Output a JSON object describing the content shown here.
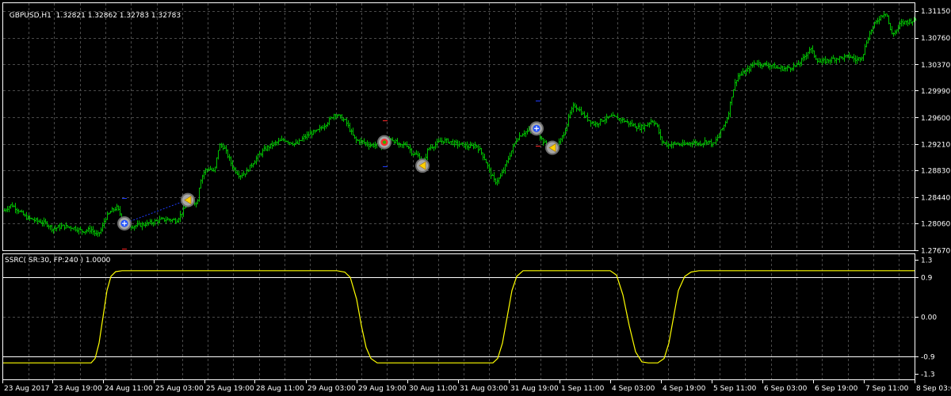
{
  "header": {
    "symbol_tf": "GBPUSD,H1",
    "ohlc": "1.32821 1.32862 1.32783 1.32783"
  },
  "indicator": {
    "label": "SSRC( SR:30, FP:240 ) 1.0000",
    "levels": {
      "upper": 0.9,
      "lower": -0.9
    }
  },
  "colors": {
    "background": "#000000",
    "grid": "#4a4a4a",
    "border": "#ffffff",
    "candles": "#00c000",
    "indicator_line": "#ffff00",
    "level_lines": "#ffffff",
    "signal_up": "#1e3cff",
    "signal_down": "#ff2a2a",
    "marker_ring": "#9a9a9a"
  },
  "chart_data": [
    {
      "type": "line",
      "title": "GBPUSD,H1",
      "y_axis_ticks": [
        "1.31150",
        "1.30760",
        "1.30370",
        "1.29990",
        "1.29600",
        "1.29210",
        "1.28830",
        "1.28440",
        "1.28060",
        "1.27670"
      ],
      "ylim": [
        1.2767,
        1.3125
      ],
      "x_axis_ticks": [
        "23 Aug 2017",
        "23 Aug 19:00",
        "24 Aug 11:00",
        "25 Aug 03:00",
        "25 Aug 19:00",
        "28 Aug 11:00",
        "29 Aug 03:00",
        "29 Aug 19:00",
        "30 Aug 11:00",
        "31 Aug 03:00",
        "31 Aug 19:00",
        "1 Sep 11:00",
        "4 Sep 03:00",
        "4 Sep 19:00",
        "5 Sep 11:00",
        "6 Sep 03:00",
        "6 Sep 19:00",
        "7 Sep 11:00",
        "8 Sep 03:00"
      ],
      "price_path": [
        [
          0,
          1.282
        ],
        [
          8,
          1.2828
        ],
        [
          14,
          1.2833
        ],
        [
          22,
          1.2826
        ],
        [
          32,
          1.2815
        ],
        [
          45,
          1.281
        ],
        [
          58,
          1.2806
        ],
        [
          66,
          1.2798
        ],
        [
          78,
          1.2802
        ],
        [
          92,
          1.28
        ],
        [
          103,
          1.2795
        ],
        [
          115,
          1.2797
        ],
        [
          122,
          1.2788
        ],
        [
          128,
          1.2798
        ],
        [
          132,
          1.2813
        ],
        [
          140,
          1.2824
        ],
        [
          147,
          1.2829
        ],
        [
          152,
          1.2818
        ],
        [
          158,
          1.2805
        ],
        [
          166,
          1.2802
        ],
        [
          178,
          1.2804
        ],
        [
          190,
          1.2807
        ],
        [
          202,
          1.2811
        ],
        [
          212,
          1.2812
        ],
        [
          222,
          1.281
        ],
        [
          230,
          1.2823
        ],
        [
          236,
          1.2835
        ],
        [
          242,
          1.284
        ],
        [
          246,
          1.2836
        ],
        [
          248,
          1.2833
        ],
        [
          252,
          1.2868
        ],
        [
          258,
          1.2883
        ],
        [
          264,
          1.2886
        ],
        [
          270,
          1.288
        ],
        [
          276,
          1.292
        ],
        [
          282,
          1.2917
        ],
        [
          288,
          1.2902
        ],
        [
          294,
          1.2886
        ],
        [
          302,
          1.2876
        ],
        [
          310,
          1.288
        ],
        [
          318,
          1.2893
        ],
        [
          326,
          1.2905
        ],
        [
          334,
          1.2914
        ],
        [
          342,
          1.292
        ],
        [
          350,
          1.2924
        ],
        [
          358,
          1.2928
        ],
        [
          366,
          1.2924
        ],
        [
          374,
          1.2921
        ],
        [
          382,
          1.293
        ],
        [
          392,
          1.2937
        ],
        [
          400,
          1.294
        ],
        [
          408,
          1.2948
        ],
        [
          416,
          1.2957
        ],
        [
          422,
          1.2966
        ],
        [
          428,
          1.2961
        ],
        [
          436,
          1.2954
        ],
        [
          442,
          1.294
        ],
        [
          448,
          1.2927
        ],
        [
          456,
          1.2925
        ],
        [
          466,
          1.292
        ],
        [
          476,
          1.292
        ],
        [
          485,
          1.2922
        ],
        [
          492,
          1.293
        ],
        [
          498,
          1.2925
        ],
        [
          504,
          1.2918
        ],
        [
          512,
          1.2922
        ],
        [
          520,
          1.2908
        ],
        [
          528,
          1.2904
        ],
        [
          534,
          1.2894
        ],
        [
          540,
          1.2915
        ],
        [
          548,
          1.292
        ],
        [
          556,
          1.2926
        ],
        [
          564,
          1.2926
        ],
        [
          574,
          1.2922
        ],
        [
          584,
          1.292
        ],
        [
          592,
          1.2917
        ],
        [
          600,
          1.292
        ],
        [
          606,
          1.2911
        ],
        [
          612,
          1.2898
        ],
        [
          618,
          1.288
        ],
        [
          624,
          1.2866
        ],
        [
          630,
          1.2872
        ],
        [
          636,
          1.2886
        ],
        [
          644,
          1.2909
        ],
        [
          652,
          1.293
        ],
        [
          660,
          1.2938
        ],
        [
          668,
          1.2941
        ],
        [
          676,
          1.2945
        ],
        [
          682,
          1.293
        ],
        [
          690,
          1.2918
        ],
        [
          698,
          1.2916
        ],
        [
          706,
          1.2924
        ],
        [
          712,
          1.294
        ],
        [
          718,
          1.2963
        ],
        [
          724,
          1.2978
        ],
        [
          730,
          1.2972
        ],
        [
          736,
          1.2963
        ],
        [
          742,
          1.2957
        ],
        [
          750,
          1.295
        ],
        [
          760,
          1.2957
        ],
        [
          772,
          1.2961
        ],
        [
          784,
          1.2957
        ],
        [
          796,
          1.295
        ],
        [
          806,
          1.2945
        ],
        [
          814,
          1.2948
        ],
        [
          822,
          1.2956
        ],
        [
          828,
          1.295
        ],
        [
          834,
          1.2926
        ],
        [
          842,
          1.292
        ],
        [
          852,
          1.2922
        ],
        [
          862,
          1.292
        ],
        [
          872,
          1.2924
        ],
        [
          882,
          1.2922
        ],
        [
          892,
          1.2926
        ],
        [
          900,
          1.292
        ],
        [
          906,
          1.2933
        ],
        [
          912,
          1.2946
        ],
        [
          918,
          1.2962
        ],
        [
          924,
          1.2998
        ],
        [
          930,
          1.302
        ],
        [
          936,
          1.3023
        ],
        [
          944,
          1.303
        ],
        [
          952,
          1.304
        ],
        [
          962,
          1.3037
        ],
        [
          972,
          1.3036
        ],
        [
          980,
          1.3032
        ],
        [
          990,
          1.3031
        ],
        [
          998,
          1.3033
        ],
        [
          1006,
          1.3036
        ],
        [
          1014,
          1.3047
        ],
        [
          1022,
          1.3061
        ],
        [
          1028,
          1.3048
        ],
        [
          1034,
          1.304
        ],
        [
          1044,
          1.3043
        ],
        [
          1054,
          1.3046
        ],
        [
          1062,
          1.3047
        ],
        [
          1072,
          1.3049
        ],
        [
          1080,
          1.3043
        ],
        [
          1088,
          1.305
        ],
        [
          1094,
          1.3074
        ],
        [
          1100,
          1.309
        ],
        [
          1106,
          1.31
        ],
        [
          1112,
          1.3109
        ],
        [
          1118,
          1.3113
        ],
        [
          1124,
          1.3081
        ],
        [
          1130,
          1.3085
        ],
        [
          1136,
          1.3097
        ],
        [
          1142,
          1.3099
        ],
        [
          1148,
          1.31
        ],
        [
          1154,
          1.3102
        ]
      ],
      "signals": [
        {
          "kind": "buy",
          "x": 157,
          "price": 1.2806
        },
        {
          "kind": "sell",
          "x": 237,
          "price": 1.284
        },
        {
          "kind": "both",
          "x": 485,
          "price": 1.2924
        },
        {
          "kind": "sell",
          "x": 533,
          "price": 1.289
        },
        {
          "kind": "buy",
          "x": 677,
          "price": 1.2944
        },
        {
          "kind": "sell",
          "x": 697,
          "price": 1.2916
        }
      ],
      "signal_ticks": [
        {
          "x": 157,
          "price": 1.2843,
          "color": "signal_up"
        },
        {
          "x": 157,
          "price": 1.2769,
          "color": "signal_down"
        },
        {
          "x": 486,
          "price": 1.2956,
          "color": "signal_down"
        },
        {
          "x": 486,
          "price": 1.2889,
          "color": "signal_up"
        },
        {
          "x": 679,
          "price": 1.2984,
          "color": "signal_up"
        },
        {
          "x": 679,
          "price": 1.2919,
          "color": "signal_down"
        }
      ],
      "dotted_segments": [
        {
          "x1": 157,
          "p1": 1.2806,
          "x2": 236,
          "p2": 1.284
        }
      ]
    },
    {
      "type": "line",
      "title": "SSRC( SR:30, FP:240 ) 1.0000",
      "y_axis_ticks": [
        "1.3",
        "0.9",
        "0.00",
        "-0.9",
        "-1.3"
      ],
      "ylim": [
        -1.3,
        1.3
      ],
      "points": [
        [
          4,
          -1.05
        ],
        [
          115,
          -1.05
        ],
        [
          120,
          -0.95
        ],
        [
          125,
          -0.6
        ],
        [
          130,
          0.0
        ],
        [
          135,
          0.6
        ],
        [
          140,
          0.92
        ],
        [
          146,
          1.03
        ],
        [
          154,
          1.05
        ],
        [
          425,
          1.05
        ],
        [
          435,
          1.02
        ],
        [
          442,
          0.9
        ],
        [
          450,
          0.4
        ],
        [
          456,
          -0.2
        ],
        [
          462,
          -0.7
        ],
        [
          468,
          -0.95
        ],
        [
          476,
          -1.05
        ],
        [
          622,
          -1.05
        ],
        [
          628,
          -0.95
        ],
        [
          634,
          -0.6
        ],
        [
          640,
          0.0
        ],
        [
          646,
          0.6
        ],
        [
          652,
          0.92
        ],
        [
          660,
          1.05
        ],
        [
          770,
          1.05
        ],
        [
          778,
          0.95
        ],
        [
          786,
          0.5
        ],
        [
          794,
          -0.2
        ],
        [
          802,
          -0.8
        ],
        [
          810,
          -1.03
        ],
        [
          818,
          -1.05
        ],
        [
          830,
          -1.05
        ],
        [
          838,
          -0.95
        ],
        [
          844,
          -0.6
        ],
        [
          850,
          0.0
        ],
        [
          856,
          0.6
        ],
        [
          864,
          0.92
        ],
        [
          872,
          1.02
        ],
        [
          882,
          1.05
        ],
        [
          1154,
          1.05
        ]
      ]
    }
  ]
}
